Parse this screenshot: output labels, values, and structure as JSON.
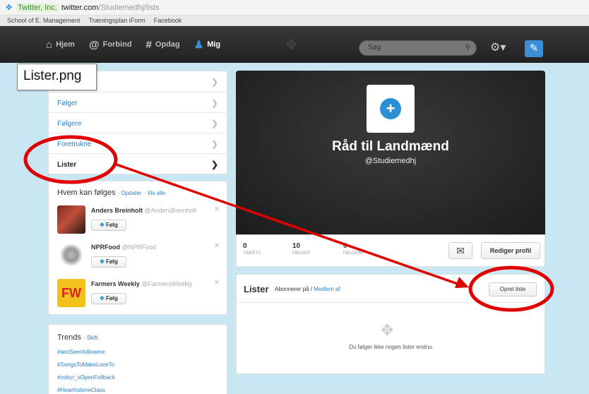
{
  "browser": {
    "secure_label": "Twitter, Inc.",
    "host": "twitter.com",
    "path": "/Studiemedhj/lists",
    "bookmarks": [
      "School of E. Management",
      "Træningsplan iForm",
      "Facebook"
    ]
  },
  "topbar": {
    "nav": [
      {
        "label": "Hjem",
        "icon": "home-icon"
      },
      {
        "label": "Forbind",
        "icon": "at-icon"
      },
      {
        "label": "Opdag",
        "icon": "hash-icon"
      },
      {
        "label": "Mig",
        "icon": "person-icon"
      }
    ],
    "search_placeholder": "Søg",
    "colors": {
      "bar": "#222222",
      "accent": "#3b8dd6"
    }
  },
  "annotation": {
    "filename": "Lister.png",
    "color": "#e00000"
  },
  "sidebar": {
    "items": [
      {
        "label": ""
      },
      {
        "label": "Følger"
      },
      {
        "label": "Følgere"
      },
      {
        "label": "Foretrukne"
      },
      {
        "label": "Lister"
      }
    ]
  },
  "who_to_follow": {
    "title": "Hvem kan følges",
    "refresh": "Opdater",
    "view_all": "Vis alle",
    "follow_label": "Følg",
    "people": [
      {
        "name": "Anders Breinholt",
        "handle": "@AndersBreinholt"
      },
      {
        "name": "NPRFood",
        "handle": "@NPRFood"
      },
      {
        "name": "Farmers Weekly",
        "handle": "@FarmersWeekly"
      }
    ]
  },
  "trends": {
    "title": "Trends",
    "change": "Skift",
    "items": [
      "#aintSeenfollowme",
      "#SongsToMakeLoveTo",
      "#cobyr_sOpenFollback",
      "#HearthstoneClass"
    ]
  },
  "profile": {
    "name": "Råd til Landmænd",
    "handle": "@Studiemedhj",
    "stats": [
      {
        "value": "0",
        "label": "TWEETS"
      },
      {
        "value": "10",
        "label": "FØLGER"
      },
      {
        "value": "0",
        "label": "FØLGERE"
      }
    ],
    "edit_label": "Rediger profil"
  },
  "lists": {
    "title": "Lister",
    "subscribed": "Abonnerer på",
    "member_of": "Medlem af",
    "create_label": "Opret liste",
    "empty_message": "Du følger ikke nogen lister endnu."
  }
}
